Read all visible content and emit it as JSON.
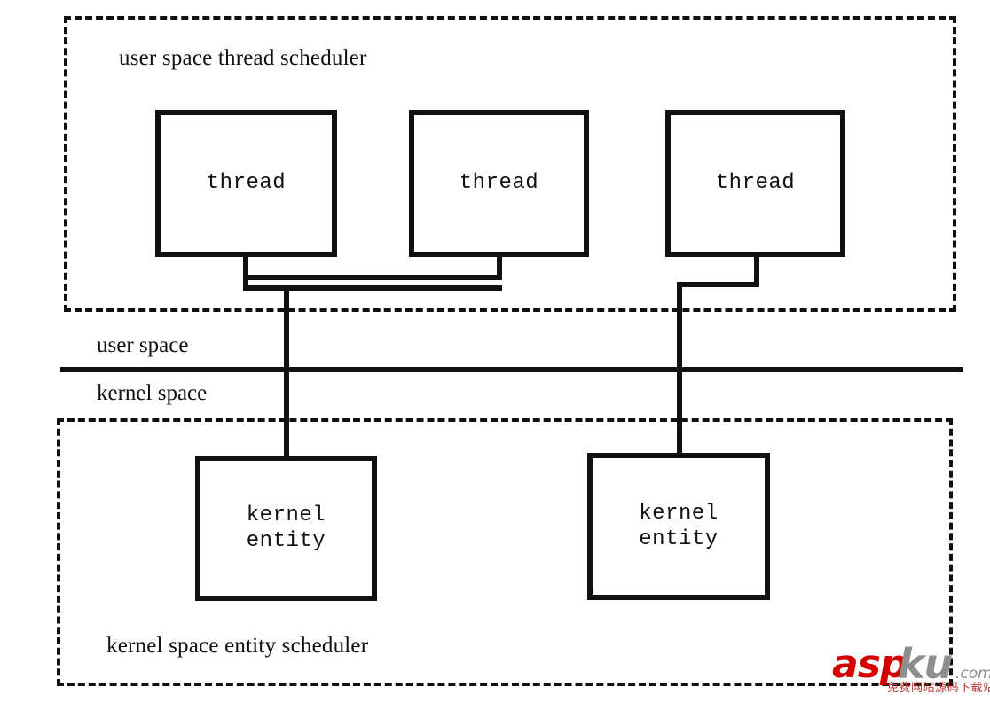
{
  "diagram": {
    "regions": {
      "user": {
        "caption": "user space thread scheduler",
        "nodes": [
          {
            "label": "thread"
          },
          {
            "label": "thread"
          },
          {
            "label": "thread"
          }
        ]
      },
      "kernel": {
        "caption": "kernel space entity scheduler",
        "nodes": [
          {
            "label": "kernel\nentity"
          },
          {
            "label": "kernel\nentity"
          }
        ]
      }
    },
    "boundary": {
      "upper_label": "user space",
      "lower_label": "kernel space"
    },
    "colors": {
      "ink": "#111111",
      "background": "#ffffff",
      "watermark_red": "#d40000",
      "watermark_gray": "#8e8e8e",
      "watermark_subtitle": "#b8362f"
    }
  },
  "watermark": {
    "brand_primary": "asp",
    "brand_secondary": "ku",
    "domain_suffix": ".com",
    "subtitle": "免费网站源码下载站"
  }
}
